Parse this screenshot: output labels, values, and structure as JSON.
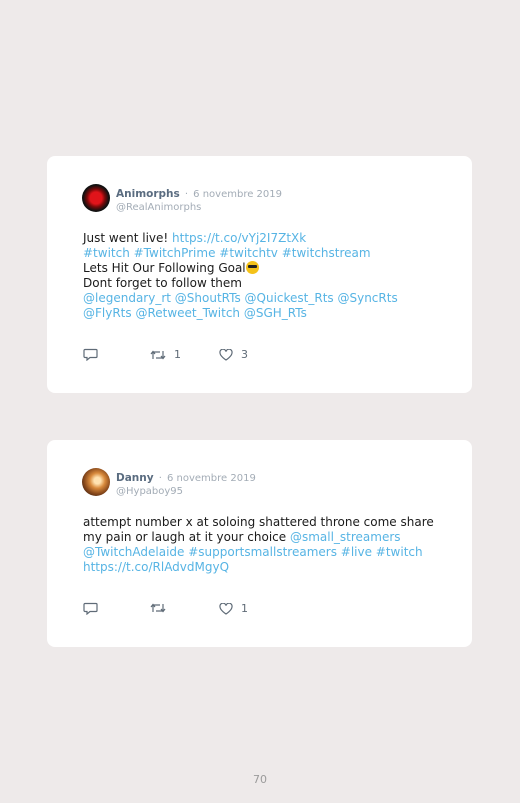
{
  "tweets": [
    {
      "name": "Animorphs",
      "dot": "·",
      "date": "6 novembre 2019",
      "handle": "@RealAnimorphs",
      "line1_text": "Just went live! ",
      "line1_link": "https://t.co/vYj2I7ZtXk",
      "line2_tags": "#twitch #TwitchPrime #twitchtv #twitchstream",
      "line3": "Lets Hit Our Following Goal",
      "line4": "Dont forget to follow them",
      "line5_mentions": "@legendary_rt @ShoutRTs @Quickest_Rts @SyncRts",
      "line6_mentions": "@FlyRts @Retweet_Twitch @SGH_RTs",
      "retweets": "1",
      "likes": "3"
    },
    {
      "name": "Danny",
      "dot": "·",
      "date": "6 novembre 2019",
      "handle": "@Hypaboy95",
      "line1": "attempt number x at soloing shattered throne come share",
      "line2_text": "my pain or laugh at it your choice ",
      "line2_mention": "@small_streamers",
      "line3_tags": "@TwitchAdelaide #supportsmallstreamers #live #twitch",
      "line4_link": "https://t.co/RlAdvdMgyQ",
      "likes": "1"
    }
  ],
  "icons": {
    "reply": "reply-icon",
    "retweet": "retweet-icon",
    "like": "heart-icon",
    "emoji": "sunglasses-emoji"
  },
  "colors": {
    "link": "#57b4e4",
    "background": "#eeeaea",
    "card": "#ffffff"
  },
  "page_number": "70"
}
